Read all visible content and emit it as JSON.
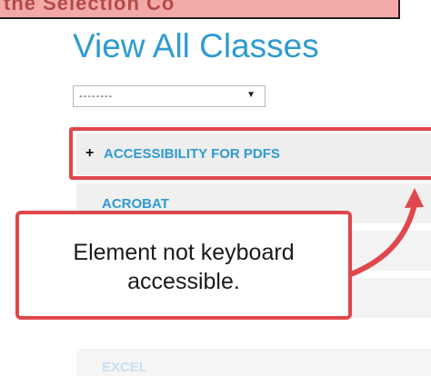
{
  "top_banner": {
    "text": "the Selection Co"
  },
  "page": {
    "title": "View All Classes"
  },
  "filter": {
    "selected": "--------"
  },
  "classes": [
    {
      "label": "ACCESSIBILITY FOR PDFS",
      "expand_symbol": "+"
    },
    {
      "label": "ACROBAT"
    },
    {
      "label": "EXCEL"
    }
  ],
  "callout": {
    "line1": "Element not keyboard",
    "line2": "accessible."
  },
  "colors": {
    "title": "#2f9bd0",
    "annotation_red": "#e0474c",
    "banner": "#f4a9a9",
    "row_bg": "#f1f1f1"
  },
  "icons": {
    "dropdown": "triangle-down",
    "expand": "plus",
    "pointer": "curved-arrow"
  }
}
